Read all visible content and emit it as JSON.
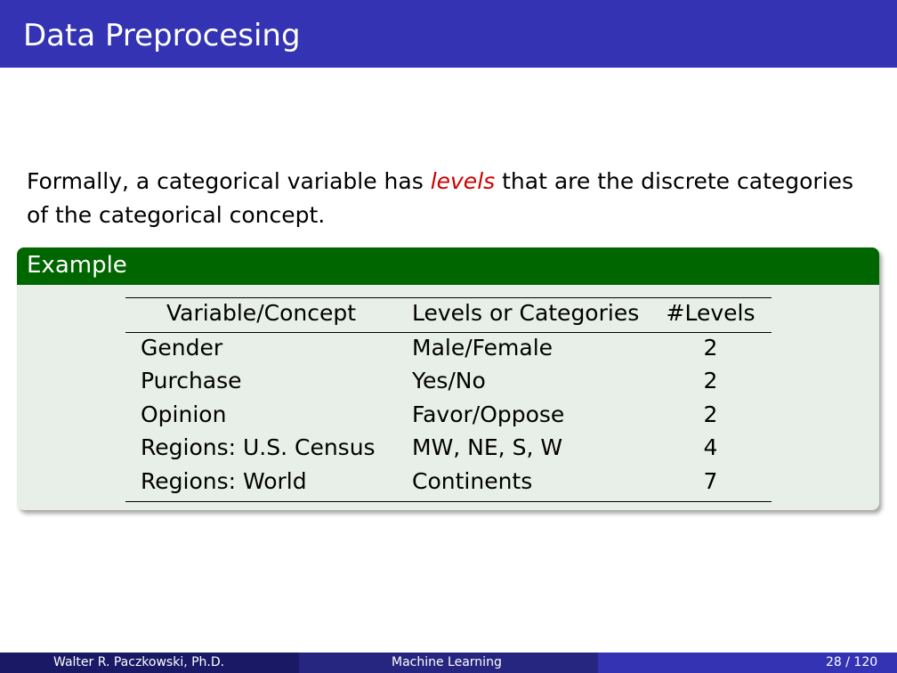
{
  "header": {
    "title": "Data Preprocesing"
  },
  "intro": {
    "before": "Formally, a categorical variable has ",
    "emphasis": "levels",
    "after": " that are the discrete categories of the categorical concept."
  },
  "example": {
    "title": "Example",
    "columns": [
      "Variable/Concept",
      "Levels or Categories",
      "#Levels"
    ],
    "rows": [
      [
        "Gender",
        "Male/Female",
        "2"
      ],
      [
        "Purchase",
        "Yes/No",
        "2"
      ],
      [
        "Opinion",
        "Favor/Oppose",
        "2"
      ],
      [
        "Regions: U.S. Census",
        "MW, NE, S, W",
        "4"
      ],
      [
        "Regions: World",
        "Continents",
        "7"
      ]
    ]
  },
  "footer": {
    "author": "Walter R. Paczkowski, Ph.D.",
    "course": "Machine Learning",
    "page": "28 / 120"
  },
  "colors": {
    "title_bar": "#3333b3",
    "block_header": "#006600",
    "block_body": "#e8efe8",
    "emphasis": "#cc0000"
  }
}
